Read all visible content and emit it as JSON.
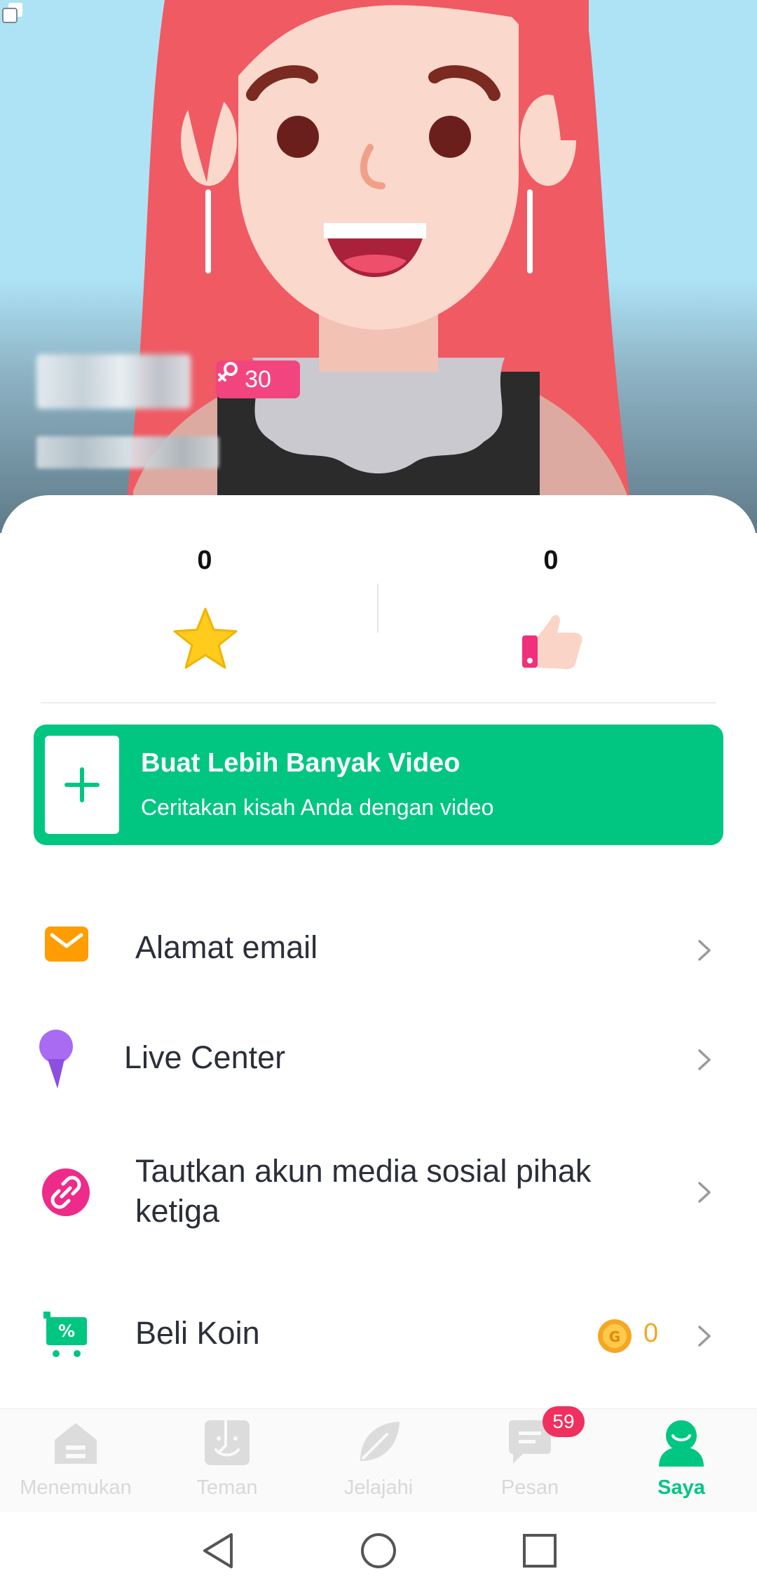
{
  "profile": {
    "level": "30"
  },
  "stats": {
    "favorites": "0",
    "likes": "0"
  },
  "banner": {
    "title": "Buat Lebih Banyak Video",
    "subtitle": "Ceritakan kisah Anda dengan video"
  },
  "menu": {
    "email": "Alamat email",
    "live": "Live Center",
    "link_social": "Tautkan akun media sosial pihak ketiga",
    "buy_coins": "Beli Koin",
    "coins": "0"
  },
  "nav": {
    "discover": "Menemukan",
    "friends": "Teman",
    "explore": "Jelajahi",
    "messages": "Pesan",
    "me": "Saya",
    "messages_badge": "59"
  },
  "colors": {
    "accent": "#00c681",
    "badge": "#f2457f",
    "coin": "#f5a623"
  }
}
